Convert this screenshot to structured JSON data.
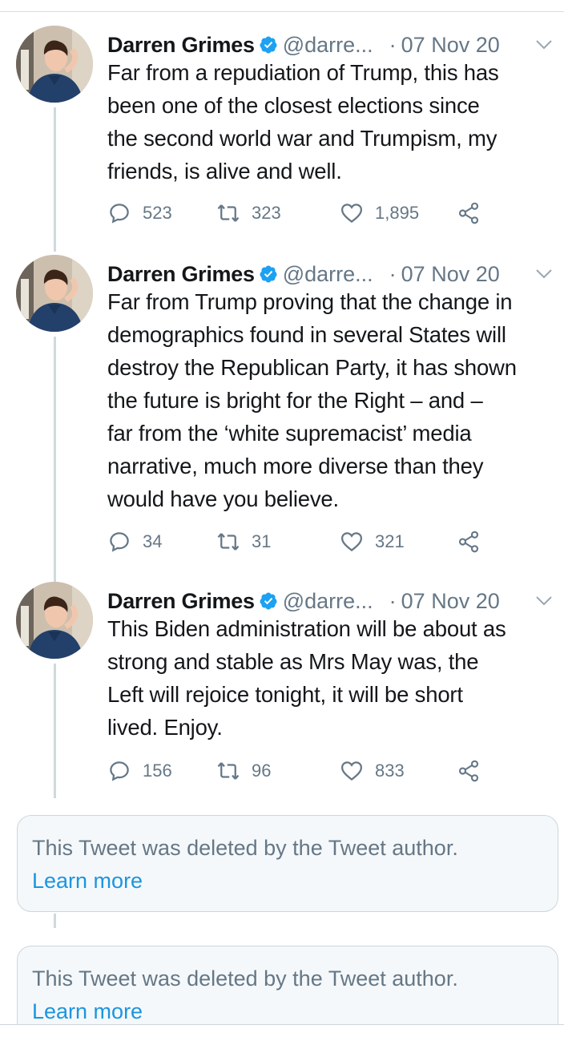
{
  "tweets": [
    {
      "name": "Darren Grimes",
      "handle": "@darre...",
      "dot": "·",
      "date": "07 Nov 20",
      "text": "Far from a repudiation of Trump, this has\nbeen one of the closest elections since\nthe second world war and Trumpism, my\nfriends, is alive and well.",
      "replies": "523",
      "retweets": "323",
      "likes": "1,895"
    },
    {
      "name": "Darren Grimes",
      "handle": "@darre...",
      "dot": "·",
      "date": "07 Nov 20",
      "text": "Far from Trump proving that the change in\ndemographics found in several States will\ndestroy the Republican Party, it has shown\nthe future is bright for the Right – and –\nfar from the ‘white supremacist’ media\nnarrative, much more diverse than they\nwould have you believe.",
      "replies": "34",
      "retweets": "31",
      "likes": "321"
    },
    {
      "name": "Darren Grimes",
      "handle": "@darre...",
      "dot": "·",
      "date": "07 Nov 20",
      "text": "This Biden administration will be about as\nstrong and stable as Mrs May was, the\nLeft will rejoice tonight, it will be short\nlived. Enjoy.",
      "replies": "156",
      "retweets": "96",
      "likes": "833"
    }
  ],
  "deleted": [
    {
      "message": "This Tweet was deleted by the Tweet author.",
      "link": "Learn more"
    },
    {
      "message": "This Tweet was deleted by the Tweet author.",
      "link": "Learn more"
    }
  ],
  "colors": {
    "verified": "#1da1f2",
    "secondary_text": "#657786",
    "link": "#1b95e0",
    "thread_line": "#cfd9de"
  },
  "icons": [
    "verified-badge-icon",
    "chevron-down-icon",
    "reply-icon",
    "retweet-icon",
    "like-icon",
    "share-icon"
  ]
}
